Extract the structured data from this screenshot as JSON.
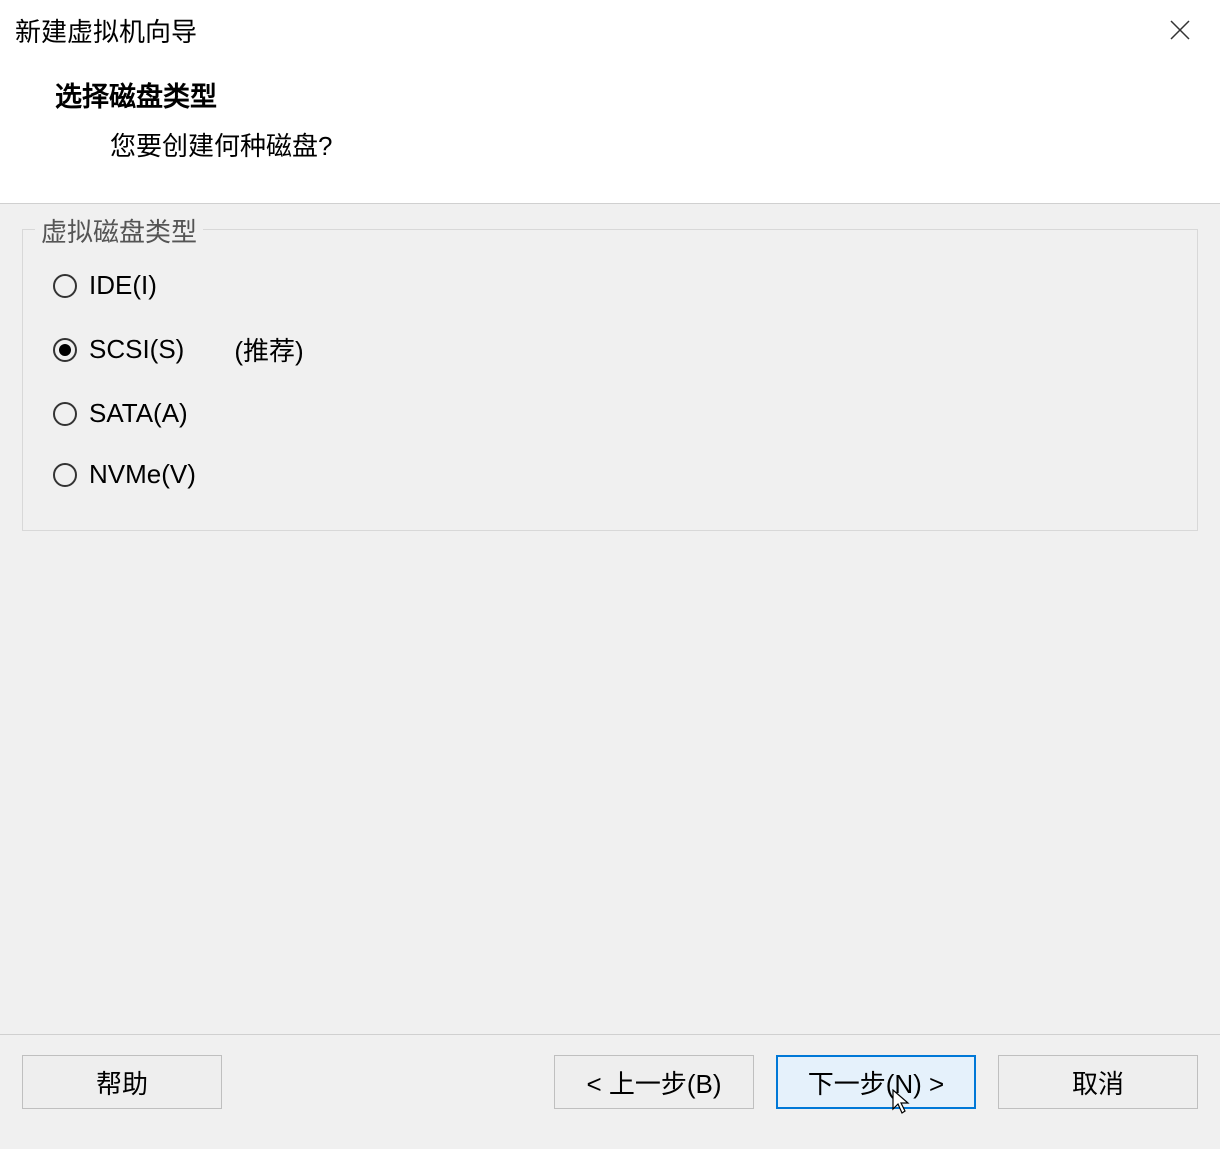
{
  "window": {
    "title": "新建虚拟机向导"
  },
  "header": {
    "title": "选择磁盘类型",
    "subtitle": "您要创建何种磁盘?"
  },
  "group": {
    "legend": "虚拟磁盘类型",
    "options": [
      {
        "label": "IDE(I)",
        "selected": false,
        "note": ""
      },
      {
        "label": "SCSI(S)",
        "selected": true,
        "note": "(推荐)"
      },
      {
        "label": "SATA(A)",
        "selected": false,
        "note": ""
      },
      {
        "label": "NVMe(V)",
        "selected": false,
        "note": ""
      }
    ]
  },
  "buttons": {
    "help": "帮助",
    "back": "< 上一步(B)",
    "next": "下一步(N) >",
    "cancel": "取消"
  }
}
